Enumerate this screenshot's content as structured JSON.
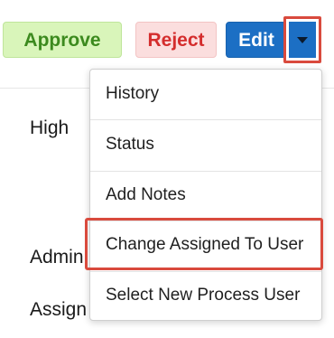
{
  "actions": {
    "approve_label": "Approve",
    "reject_label": "Reject",
    "edit_label": "Edit",
    "dropdown_icon": "caret-down"
  },
  "fields": {
    "high_label": "High",
    "admin_label": "Admin",
    "assign_label": "Assign"
  },
  "menu": {
    "items": [
      {
        "label": "History"
      },
      {
        "label": "Status"
      },
      {
        "label": "Add Notes"
      },
      {
        "label": "Change Assigned To User",
        "highlighted": true
      },
      {
        "label": "Select New Process User"
      }
    ]
  },
  "colors": {
    "approve_bg": "#d9f5ba",
    "approve_text": "#3c8a1e",
    "reject_bg": "#fbdede",
    "reject_text": "#d42d2d",
    "edit_bg": "#1c6fc4",
    "highlight": "#d94a3d"
  }
}
